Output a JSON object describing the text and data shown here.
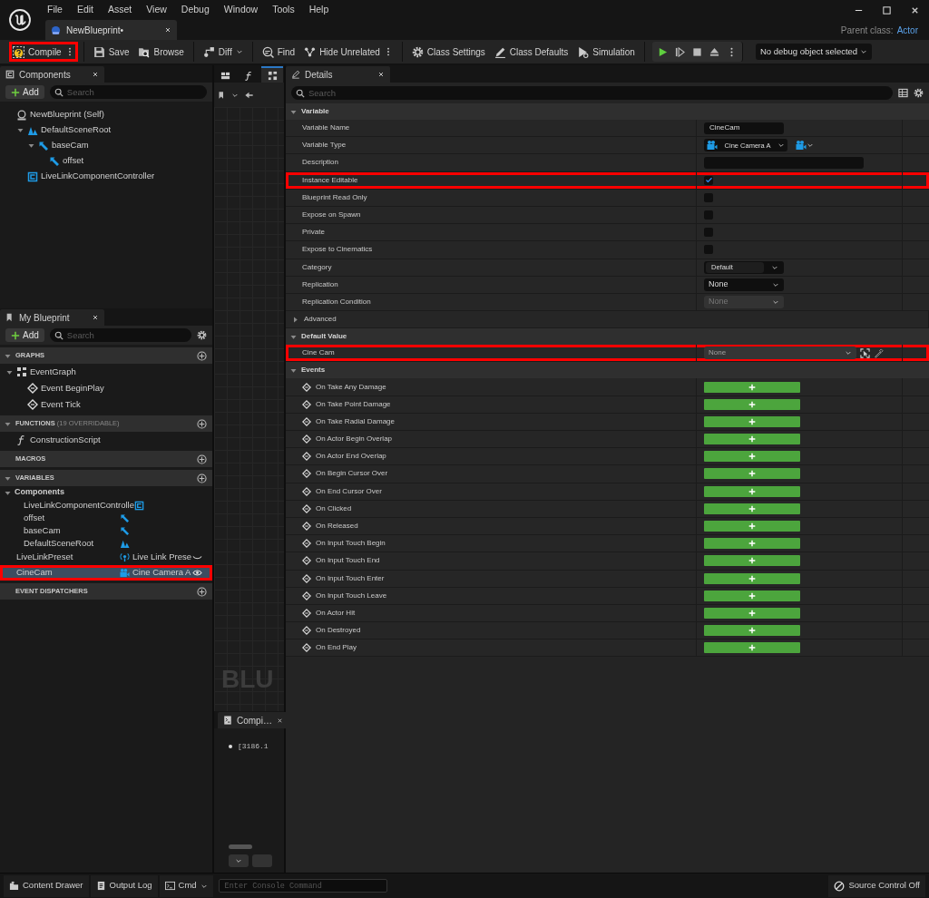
{
  "menu": [
    "File",
    "Edit",
    "Asset",
    "View",
    "Debug",
    "Window",
    "Tools",
    "Help"
  ],
  "document_tab": {
    "label": "NewBlueprint•",
    "selected": true
  },
  "parent_class": {
    "label": "Parent class:",
    "value": "Actor"
  },
  "toolbar": [
    [
      {
        "kind": "compile",
        "label": "Compile",
        "highlighted": true,
        "options": true,
        "dropdown": false
      }
    ],
    [
      {
        "kind": "save",
        "label": "Save",
        "highlighted": false,
        "options": false,
        "dropdown": false
      },
      {
        "kind": "browse",
        "label": "Browse",
        "highlighted": false,
        "options": false,
        "dropdown": false
      }
    ],
    [
      {
        "kind": "diff",
        "label": "Diff",
        "highlighted": false,
        "options": false,
        "dropdown": true
      }
    ],
    [
      {
        "kind": "find",
        "label": "Find",
        "highlighted": false,
        "options": false,
        "dropdown": false
      },
      {
        "kind": "hide",
        "label": "Hide Unrelated",
        "highlighted": false,
        "options": true,
        "dropdown": false
      }
    ],
    [
      {
        "kind": "settings",
        "label": "Class Settings",
        "highlighted": false,
        "options": false,
        "dropdown": false
      },
      {
        "kind": "defaults",
        "label": "Class Defaults",
        "highlighted": false,
        "options": false,
        "dropdown": false
      },
      {
        "kind": "simulation",
        "label": "Simulation",
        "highlighted": false,
        "options": false,
        "dropdown": false
      }
    ]
  ],
  "debug_filter": {
    "label": "No debug object selected"
  },
  "components": {
    "title": "Components",
    "add_label": "Add",
    "search_placeholder": "Search",
    "tree": [
      {
        "label": "NewBlueprint (Self)",
        "kind": "self",
        "children": [
          {
            "label": "DefaultSceneRoot",
            "kind": "scene",
            "expanded": true,
            "children": [
              {
                "label": "baseCam",
                "kind": "arm",
                "expanded": true,
                "children": [
                  {
                    "label": "offset",
                    "kind": "arm"
                  }
                ]
              }
            ]
          },
          {
            "label": "LiveLinkComponentController",
            "kind": "component"
          }
        ]
      }
    ]
  },
  "my_blueprint": {
    "title": "My Blueprint",
    "add_label": "Add",
    "search_placeholder": "Search",
    "sections": [
      {
        "title": "GRAPHS",
        "expanded": true,
        "items": [
          {
            "label": "EventGraph",
            "kind": "graph",
            "expanded": true,
            "children": [
              {
                "label": "Event BeginPlay",
                "kind": "event"
              },
              {
                "label": "Event Tick",
                "kind": "event"
              }
            ]
          }
        ]
      },
      {
        "title": "FUNCTIONS",
        "note": "(19 OVERRIDABLE)",
        "expanded": true,
        "items": [
          {
            "label": "ConstructionScript",
            "kind": "function"
          }
        ]
      },
      {
        "title": "MACROS"
      },
      {
        "title": "VARIABLES",
        "expanded": true,
        "variables": [
          {
            "label": "Components",
            "expanded": true,
            "children": [
              {
                "label": "LiveLinkComponentControlle",
                "kind": "component"
              },
              {
                "label": "offset",
                "kind": "arm"
              },
              {
                "label": "baseCam",
                "kind": "arm"
              },
              {
                "label": "DefaultSceneRoot",
                "kind": "scene"
              }
            ]
          },
          {
            "kind": "preset",
            "label": "LiveLinkPreset",
            "type_label": "Live Link Prese",
            "public": false,
            "selected": false,
            "highlighted": false
          },
          {
            "kind": "camera",
            "label": "CineCam",
            "type_label": "Cine Camera A",
            "public": true,
            "selected": true,
            "highlighted": true
          }
        ]
      },
      {
        "title": "EVENT DISPATCHERS"
      }
    ]
  },
  "graph_tabs": [
    {
      "kind": "viewport",
      "selected": false
    },
    {
      "kind": "function",
      "selected": false
    },
    {
      "kind": "event_graph",
      "selected": true
    }
  ],
  "graph": {
    "watermark": "BLU"
  },
  "compiler_results": {
    "title": "Compi…",
    "lines": [
      "[3186.1"
    ]
  },
  "details": {
    "title": "Details",
    "search_placeholder": "Search",
    "sections": [
      {
        "title": "Variable",
        "expanded": true,
        "rows": [
          {
            "label": "Variable Name",
            "kind": "text",
            "value": "CineCam",
            "highlighted": false
          },
          {
            "label": "Variable Type",
            "kind": "type",
            "value": "Cine Camera A",
            "highlighted": false
          },
          {
            "label": "Description",
            "kind": "text",
            "highlighted": false
          },
          {
            "label": "Instance Editable",
            "kind": "checkbox",
            "checked": true,
            "highlighted": true
          },
          {
            "label": "Blueprint Read Only",
            "kind": "checkbox",
            "checked": false,
            "highlighted": false
          },
          {
            "label": "Expose on Spawn",
            "kind": "checkbox",
            "checked": false,
            "highlighted": false
          },
          {
            "label": "Private",
            "kind": "checkbox",
            "checked": false,
            "highlighted": false
          },
          {
            "label": "Expose to Cinematics",
            "kind": "checkbox",
            "checked": false,
            "highlighted": false
          },
          {
            "label": "Category",
            "kind": "combo",
            "value": "Default",
            "highlighted": false
          },
          {
            "label": "Replication",
            "kind": "dropdown",
            "value": "None",
            "disabled": false,
            "highlighted": false
          },
          {
            "label": "Replication Condition",
            "kind": "dropdown",
            "value": "None",
            "disabled": true,
            "highlighted": false
          },
          {
            "label": "Advanced",
            "kind": "group",
            "expanded": false,
            "highlighted": false
          }
        ]
      },
      {
        "title": "Default Value",
        "expanded": true,
        "rows": [
          {
            "label": "Cine Cam",
            "kind": "object",
            "value": "None",
            "highlighted": true
          }
        ]
      },
      {
        "title": "Events",
        "expanded": true,
        "rows": [
          {
            "label": "On Take Any Damage",
            "kind": "event",
            "highlighted": false
          },
          {
            "label": "On Take Point Damage",
            "kind": "event",
            "highlighted": false
          },
          {
            "label": "On Take Radial Damage",
            "kind": "event",
            "highlighted": false
          },
          {
            "label": "On Actor Begin Overlap",
            "kind": "event",
            "highlighted": false
          },
          {
            "label": "On Actor End Overlap",
            "kind": "event",
            "highlighted": false
          },
          {
            "label": "On Begin Cursor Over",
            "kind": "event",
            "highlighted": false
          },
          {
            "label": "On End Cursor Over",
            "kind": "event",
            "highlighted": false
          },
          {
            "label": "On Clicked",
            "kind": "event",
            "highlighted": false
          },
          {
            "label": "On Released",
            "kind": "event",
            "highlighted": false
          },
          {
            "label": "On Input Touch Begin",
            "kind": "event",
            "highlighted": false
          },
          {
            "label": "On Input Touch End",
            "kind": "event",
            "highlighted": false
          },
          {
            "label": "On Input Touch Enter",
            "kind": "event",
            "highlighted": false
          },
          {
            "label": "On Input Touch Leave",
            "kind": "event",
            "highlighted": false
          },
          {
            "label": "On Actor Hit",
            "kind": "event",
            "highlighted": false
          },
          {
            "label": "On Destroyed",
            "kind": "event",
            "highlighted": false
          },
          {
            "label": "On End Play",
            "kind": "event",
            "highlighted": false
          }
        ]
      }
    ]
  },
  "status_bar": {
    "buttons": [
      {
        "kind": "drawer",
        "label": "Content Drawer"
      },
      {
        "kind": "log",
        "label": "Output Log"
      },
      {
        "kind": "cmd",
        "label": "Cmd"
      }
    ],
    "console_placeholder": "Enter Console Command",
    "source_control": "Source Control Off"
  }
}
